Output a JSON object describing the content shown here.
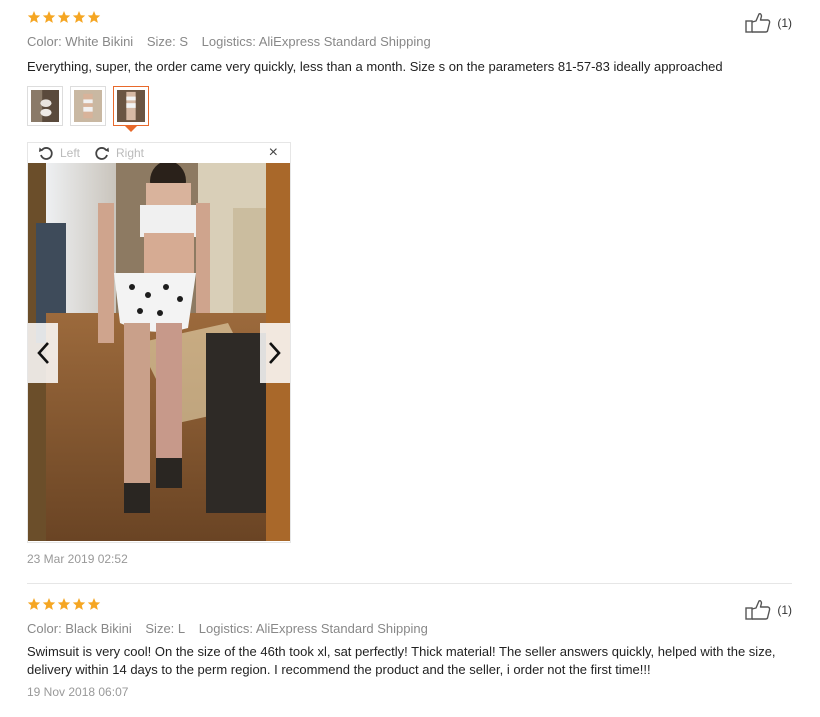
{
  "reviews": [
    {
      "rating": 5,
      "color": "Color: White Bikini",
      "size": "Size: S",
      "logistics": "Logistics: AliExpress Standard Shipping",
      "helpful_count": "(1)",
      "text": "Everything, super, the order came very quickly, less than a month. Size s on the parameters 81-57-83 ideally approached",
      "date": "23 Mar 2019 02:52",
      "viewer": {
        "rotate_left_label": "Left",
        "rotate_right_label": "Right",
        "close_glyph": "×"
      }
    },
    {
      "rating": 5,
      "color": "Color: Black Bikini",
      "size": "Size: L",
      "logistics": "Logistics: AliExpress Standard Shipping",
      "helpful_count": "(1)",
      "text": "Swimsuit is very cool! On the size of the 46th took xl, sat perfectly! Thick material! The seller answers quickly, helped with the size, delivery within 14 days to the perm region. I recommend the product and the seller, i order not the first time!!!",
      "date": "19 Nov 2018 06:07"
    }
  ],
  "colors": {
    "star": "#f5a623",
    "accent": "#e8692b",
    "meta_text": "#888888"
  },
  "icons": {
    "rating": "star-icon",
    "helpful": "thumbs-up-icon",
    "rotate_left": "rotate-left-icon",
    "rotate_right": "rotate-right-icon",
    "close": "close-icon",
    "prev": "chevron-left-icon",
    "next": "chevron-right-icon"
  }
}
